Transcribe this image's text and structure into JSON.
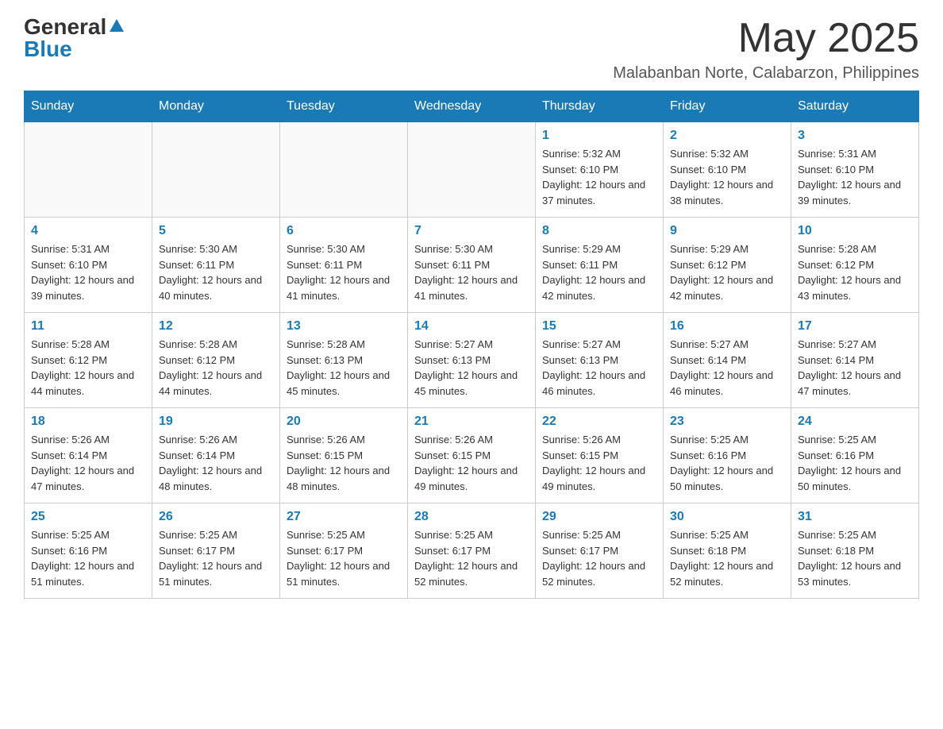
{
  "logo": {
    "general": "General",
    "blue": "Blue"
  },
  "title": {
    "month_year": "May 2025",
    "location": "Malabanban Norte, Calabarzon, Philippines"
  },
  "days_header": [
    "Sunday",
    "Monday",
    "Tuesday",
    "Wednesday",
    "Thursday",
    "Friday",
    "Saturday"
  ],
  "weeks": [
    [
      {
        "day": "",
        "info": ""
      },
      {
        "day": "",
        "info": ""
      },
      {
        "day": "",
        "info": ""
      },
      {
        "day": "",
        "info": ""
      },
      {
        "day": "1",
        "info": "Sunrise: 5:32 AM\nSunset: 6:10 PM\nDaylight: 12 hours and 37 minutes."
      },
      {
        "day": "2",
        "info": "Sunrise: 5:32 AM\nSunset: 6:10 PM\nDaylight: 12 hours and 38 minutes."
      },
      {
        "day": "3",
        "info": "Sunrise: 5:31 AM\nSunset: 6:10 PM\nDaylight: 12 hours and 39 minutes."
      }
    ],
    [
      {
        "day": "4",
        "info": "Sunrise: 5:31 AM\nSunset: 6:10 PM\nDaylight: 12 hours and 39 minutes."
      },
      {
        "day": "5",
        "info": "Sunrise: 5:30 AM\nSunset: 6:11 PM\nDaylight: 12 hours and 40 minutes."
      },
      {
        "day": "6",
        "info": "Sunrise: 5:30 AM\nSunset: 6:11 PM\nDaylight: 12 hours and 41 minutes."
      },
      {
        "day": "7",
        "info": "Sunrise: 5:30 AM\nSunset: 6:11 PM\nDaylight: 12 hours and 41 minutes."
      },
      {
        "day": "8",
        "info": "Sunrise: 5:29 AM\nSunset: 6:11 PM\nDaylight: 12 hours and 42 minutes."
      },
      {
        "day": "9",
        "info": "Sunrise: 5:29 AM\nSunset: 6:12 PM\nDaylight: 12 hours and 42 minutes."
      },
      {
        "day": "10",
        "info": "Sunrise: 5:28 AM\nSunset: 6:12 PM\nDaylight: 12 hours and 43 minutes."
      }
    ],
    [
      {
        "day": "11",
        "info": "Sunrise: 5:28 AM\nSunset: 6:12 PM\nDaylight: 12 hours and 44 minutes."
      },
      {
        "day": "12",
        "info": "Sunrise: 5:28 AM\nSunset: 6:12 PM\nDaylight: 12 hours and 44 minutes."
      },
      {
        "day": "13",
        "info": "Sunrise: 5:28 AM\nSunset: 6:13 PM\nDaylight: 12 hours and 45 minutes."
      },
      {
        "day": "14",
        "info": "Sunrise: 5:27 AM\nSunset: 6:13 PM\nDaylight: 12 hours and 45 minutes."
      },
      {
        "day": "15",
        "info": "Sunrise: 5:27 AM\nSunset: 6:13 PM\nDaylight: 12 hours and 46 minutes."
      },
      {
        "day": "16",
        "info": "Sunrise: 5:27 AM\nSunset: 6:14 PM\nDaylight: 12 hours and 46 minutes."
      },
      {
        "day": "17",
        "info": "Sunrise: 5:27 AM\nSunset: 6:14 PM\nDaylight: 12 hours and 47 minutes."
      }
    ],
    [
      {
        "day": "18",
        "info": "Sunrise: 5:26 AM\nSunset: 6:14 PM\nDaylight: 12 hours and 47 minutes."
      },
      {
        "day": "19",
        "info": "Sunrise: 5:26 AM\nSunset: 6:14 PM\nDaylight: 12 hours and 48 minutes."
      },
      {
        "day": "20",
        "info": "Sunrise: 5:26 AM\nSunset: 6:15 PM\nDaylight: 12 hours and 48 minutes."
      },
      {
        "day": "21",
        "info": "Sunrise: 5:26 AM\nSunset: 6:15 PM\nDaylight: 12 hours and 49 minutes."
      },
      {
        "day": "22",
        "info": "Sunrise: 5:26 AM\nSunset: 6:15 PM\nDaylight: 12 hours and 49 minutes."
      },
      {
        "day": "23",
        "info": "Sunrise: 5:25 AM\nSunset: 6:16 PM\nDaylight: 12 hours and 50 minutes."
      },
      {
        "day": "24",
        "info": "Sunrise: 5:25 AM\nSunset: 6:16 PM\nDaylight: 12 hours and 50 minutes."
      }
    ],
    [
      {
        "day": "25",
        "info": "Sunrise: 5:25 AM\nSunset: 6:16 PM\nDaylight: 12 hours and 51 minutes."
      },
      {
        "day": "26",
        "info": "Sunrise: 5:25 AM\nSunset: 6:17 PM\nDaylight: 12 hours and 51 minutes."
      },
      {
        "day": "27",
        "info": "Sunrise: 5:25 AM\nSunset: 6:17 PM\nDaylight: 12 hours and 51 minutes."
      },
      {
        "day": "28",
        "info": "Sunrise: 5:25 AM\nSunset: 6:17 PM\nDaylight: 12 hours and 52 minutes."
      },
      {
        "day": "29",
        "info": "Sunrise: 5:25 AM\nSunset: 6:17 PM\nDaylight: 12 hours and 52 minutes."
      },
      {
        "day": "30",
        "info": "Sunrise: 5:25 AM\nSunset: 6:18 PM\nDaylight: 12 hours and 52 minutes."
      },
      {
        "day": "31",
        "info": "Sunrise: 5:25 AM\nSunset: 6:18 PM\nDaylight: 12 hours and 53 minutes."
      }
    ]
  ]
}
